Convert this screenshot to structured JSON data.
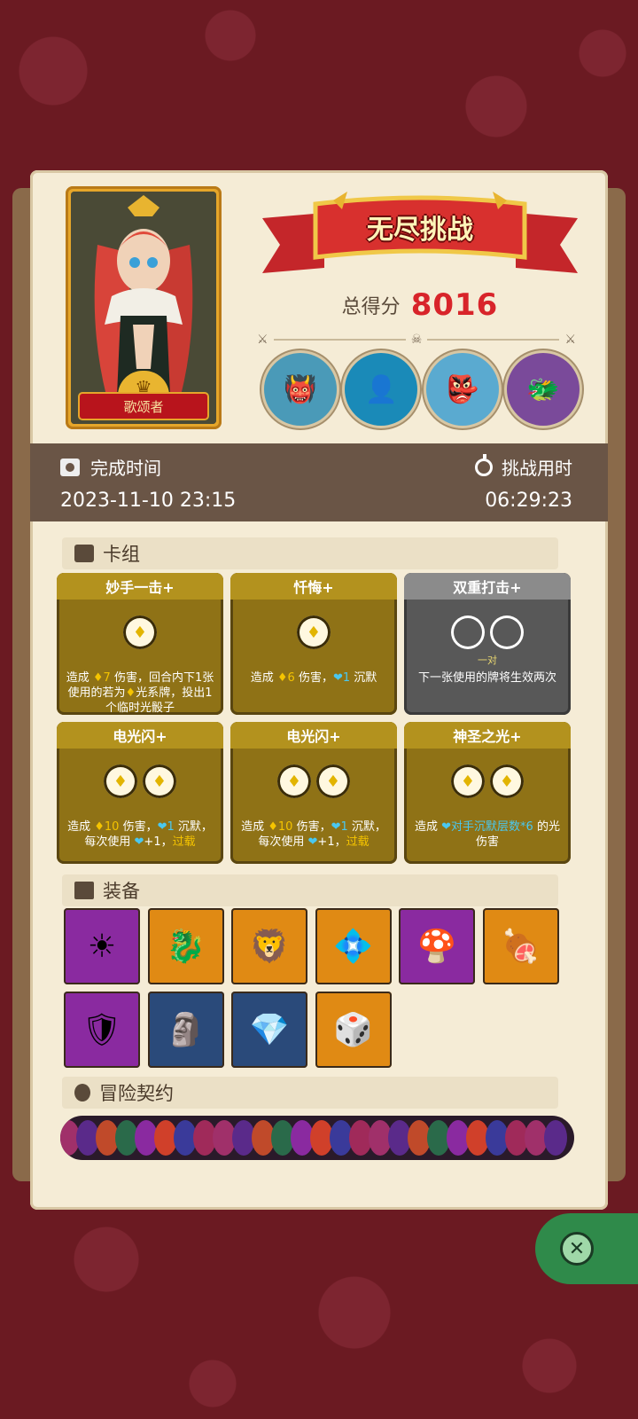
{
  "hero": {
    "name": "歌颂者"
  },
  "mode": {
    "title": "无尽挑战"
  },
  "score": {
    "label": "总得分",
    "value": "8016"
  },
  "time": {
    "finish_label": "完成时间",
    "finish_value": "2023-11-10 23:15",
    "duration_label": "挑战用时",
    "duration_value": "06:29:23"
  },
  "sections": {
    "deck": "卡组",
    "equipment": "装备",
    "contracts": "冒险契约"
  },
  "cards": [
    {
      "title": "妙手一击+",
      "style": "gold",
      "slots": 1,
      "sub": "",
      "desc_parts": [
        "造成 ",
        "♦7",
        " 伤害，回合内下1张使用的若为",
        "♦",
        "光系牌，投出1个临时光骰子"
      ]
    },
    {
      "title": "忏悔+",
      "style": "gold",
      "slots": 1,
      "sub": "",
      "desc_parts": [
        "造成 ",
        "♦6",
        " 伤害，",
        "❤1",
        " 沉默"
      ]
    },
    {
      "title": "双重打击+",
      "style": "gray",
      "slots": 2,
      "sub": "一对",
      "desc_parts": [
        "下一张使用的牌将生效两次"
      ]
    },
    {
      "title": "电光闪+",
      "style": "gold",
      "slots": 2,
      "sub": "",
      "desc_parts": [
        "造成 ",
        "♦10",
        " 伤害，",
        "❤1",
        " 沉默，每次使用 ",
        "❤",
        "+1，",
        "过载"
      ]
    },
    {
      "title": "电光闪+",
      "style": "gold",
      "slots": 2,
      "sub": "",
      "desc_parts": [
        "造成 ",
        "♦10",
        " 伤害，",
        "❤1",
        " 沉默，每次使用 ",
        "❤",
        "+1，",
        "过载"
      ]
    },
    {
      "title": "神圣之光+",
      "style": "gold",
      "slots": 2,
      "sub": "",
      "desc_parts": [
        "造成 ",
        "❤对手沉默层数*6",
        " 的光伤害"
      ]
    }
  ],
  "equipment": [
    {
      "icon": "sun-amulet-icon",
      "color": "purple",
      "glyph": "☀"
    },
    {
      "icon": "dragon-mask-icon",
      "color": "orange",
      "glyph": "🐉"
    },
    {
      "icon": "lion-ring-icon",
      "color": "orange",
      "glyph": "🦁"
    },
    {
      "icon": "skull-gem-icon",
      "color": "orange",
      "glyph": "💠"
    },
    {
      "icon": "mushroom-icon",
      "color": "purple",
      "glyph": "🍄"
    },
    {
      "icon": "meat-icon",
      "color": "orange",
      "glyph": "🍖"
    },
    {
      "icon": "armor-icon",
      "color": "purple",
      "glyph": "🛡"
    },
    {
      "icon": "totem-icon",
      "color": "blue",
      "glyph": "🗿"
    },
    {
      "icon": "crystal-icon",
      "color": "blue",
      "glyph": "💎"
    },
    {
      "icon": "dice-icon",
      "color": "orange",
      "glyph": "🎲"
    }
  ],
  "colors": {
    "panel": "#f5ecd6",
    "time_bar": "#6a5546",
    "score": "#d8242a",
    "gold_card": "#8f7216",
    "gray_card": "#585858"
  }
}
